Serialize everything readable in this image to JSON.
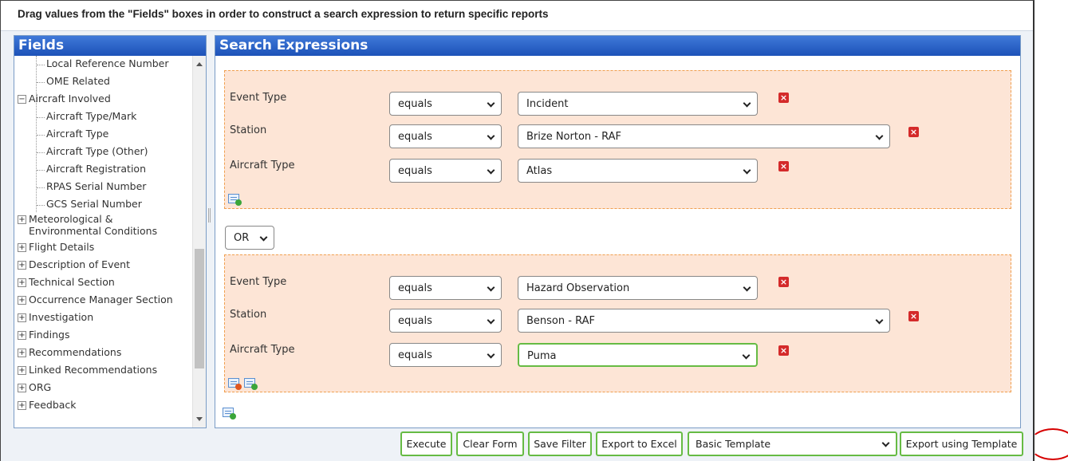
{
  "instruction": "Drag values from the \"Fields\" boxes in order to construct a search expression to return specific reports",
  "fields_panel": {
    "title": "Fields",
    "items": [
      {
        "label": "Local Reference Number",
        "level": "child"
      },
      {
        "label": "OME Related",
        "level": "child"
      },
      {
        "label": "Aircraft Involved",
        "level": "parent",
        "expander": "−"
      },
      {
        "label": "Aircraft Type/Mark",
        "level": "child"
      },
      {
        "label": "Aircraft Type",
        "level": "child"
      },
      {
        "label": "Aircraft Type (Other)",
        "level": "child"
      },
      {
        "label": "Aircraft Registration",
        "level": "child"
      },
      {
        "label": "RPAS Serial Number",
        "level": "child"
      },
      {
        "label": "GCS Serial Number",
        "level": "child"
      },
      {
        "label": "Meteorological & Environmental Conditions",
        "level": "parent",
        "expander": "+"
      },
      {
        "label": "Flight Details",
        "level": "parent",
        "expander": "+"
      },
      {
        "label": "Description of Event",
        "level": "parent",
        "expander": "+"
      },
      {
        "label": "Technical Section",
        "level": "parent",
        "expander": "+"
      },
      {
        "label": "Occurrence Manager Section",
        "level": "parent",
        "expander": "+"
      },
      {
        "label": "Investigation",
        "level": "parent",
        "expander": "+"
      },
      {
        "label": "Findings",
        "level": "parent",
        "expander": "+"
      },
      {
        "label": "Recommendations",
        "level": "parent",
        "expander": "+"
      },
      {
        "label": "Linked Recommendations",
        "level": "parent",
        "expander": "+"
      },
      {
        "label": "ORG",
        "level": "parent",
        "expander": "+"
      },
      {
        "label": "Feedback",
        "level": "parent",
        "expander": "+"
      }
    ]
  },
  "search_panel": {
    "title": "Search Expressions",
    "groups": [
      {
        "rows": [
          {
            "field": "Event Type",
            "operator": "equals",
            "value": "Incident"
          },
          {
            "field": "Station",
            "operator": "equals",
            "value": "Brize Norton - RAF"
          },
          {
            "field": "Aircraft Type",
            "operator": "equals",
            "value": "Atlas"
          }
        ]
      },
      {
        "rows": [
          {
            "field": "Event Type",
            "operator": "equals",
            "value": "Hazard Observation"
          },
          {
            "field": "Station",
            "operator": "equals",
            "value": "Benson - RAF"
          },
          {
            "field": "Aircraft Type",
            "operator": "equals",
            "value": "Puma"
          }
        ]
      }
    ],
    "connector": "OR",
    "delete_glyph": "×"
  },
  "actions": {
    "execute": "Execute",
    "clear_form": "Clear Form",
    "save_filter": "Save Filter",
    "export_excel": "Export to Excel",
    "template_selected": "Basic Template",
    "export_template": "Export using Template"
  },
  "colors": {
    "header_blue": "#1d52b8",
    "group_bg": "#fde5d6",
    "button_border": "#66bb44",
    "delete_red": "#d42a2a",
    "annotation_red": "#d60000"
  }
}
